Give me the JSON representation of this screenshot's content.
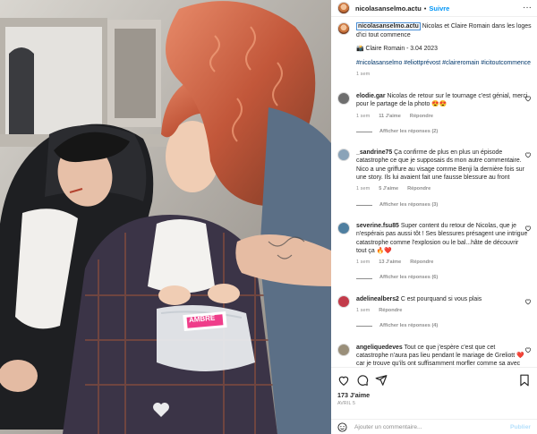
{
  "post": {
    "photo_label_text": "AMBRE",
    "author": "nicolasanselmo.actu",
    "follow_label": "Suivre",
    "header_separator": "•",
    "more_label": "···"
  },
  "caption": {
    "username": "nicolasanselmo.actu",
    "text": "Nicolas et Claire Romain dans les loges d'ici tout commence",
    "credit": "📸 Claire Romain - 3.04 2023",
    "hashtags": "#nicolasanselmo #eliottprévost #claireromain #icitoutcommence",
    "time": "1 sem"
  },
  "comments": [
    {
      "username": "elodie.gar",
      "text": "Nicolas de retour sur le tournage c'est génial, merci pour le partage de la photo 😍😍",
      "time": "1 sem",
      "likes": "11 J'aime",
      "reply": "Répondre",
      "replies_label": "Afficher les réponses (2)",
      "avatar_color": "#6e6e6e"
    },
    {
      "username": "_sandrine75",
      "text": "Ça confirme de plus en plus un épisode catastrophe ce que je supposais ds mon autre commentaire. Nico a une griffure au visage comme Benji la dernière fois sur une story. Ils lui avaient fait une fausse blessure au front",
      "time": "1 sem",
      "likes": "5 J'aime",
      "reply": "Répondre",
      "replies_label": "Afficher les réponses (3)",
      "avatar_color": "#8aa3b8"
    },
    {
      "username": "severine.fsu85",
      "text": "Super content du retour de Nicolas, que je n'espérais pas aussi tôt ! Ses blessures présagent une intrigue catastrophe comme l'explosion ou le bal...hâte de découvrir tout ça 🔥❤️",
      "time": "1 sem",
      "likes": "13 J'aime",
      "reply": "Répondre",
      "replies_label": "Afficher les réponses (6)",
      "avatar_color": "#4f7fa0"
    },
    {
      "username": "adelinealbers2",
      "text": "C est pourquand si vous plais",
      "time": "1 sem",
      "likes": "",
      "reply": "Répondre",
      "replies_label": "Afficher les réponses (4)",
      "avatar_color": "#c23b4a"
    },
    {
      "username": "angeliquedeves",
      "text": "Tout ce que j'espère c'est que cet catastrophe n'aura pas lieu pendant le mariage de Greliott ❤️ car je trouve qu'ils ont suffisamment morfler comme sa avec Nael ils mérite vraiment d'être heureux tout les 3 en famille 👪 et d'avoir un beau final pour conclure cette si jolie histoire.",
      "time": "",
      "likes": "",
      "reply": "",
      "replies_label": "",
      "avatar_color": "#9a8f7a"
    }
  ],
  "actions": {
    "likes": "173 J'aime",
    "date": "AVRIL 5"
  },
  "add_comment": {
    "placeholder": "Ajouter un commentaire...",
    "publish": "Publier"
  }
}
